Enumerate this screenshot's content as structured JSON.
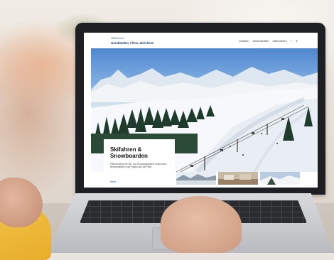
{
  "site": {
    "logo_small": "Willkommen",
    "logo_name": "Graubünden, Flims, Zürichsee",
    "nav": [
      "Erleben",
      "Übernachten",
      "Informieren"
    ],
    "nav_icons": [
      "plus-icon",
      "search-icon"
    ]
  },
  "hero": {
    "title": "Skifahren & Snowboarden",
    "text": "Pistenerlebnis für Ski- und Snowboardfahrer sowie auch Neueinsteiger in der Region auf der Piste",
    "link": "Mehr →"
  },
  "colors": {
    "sky": "#4f87cf",
    "snow": "#f5f7fa",
    "forest": "#1f3b2c",
    "link": "#2b63b0",
    "sleeve": "#e8ad2a"
  }
}
